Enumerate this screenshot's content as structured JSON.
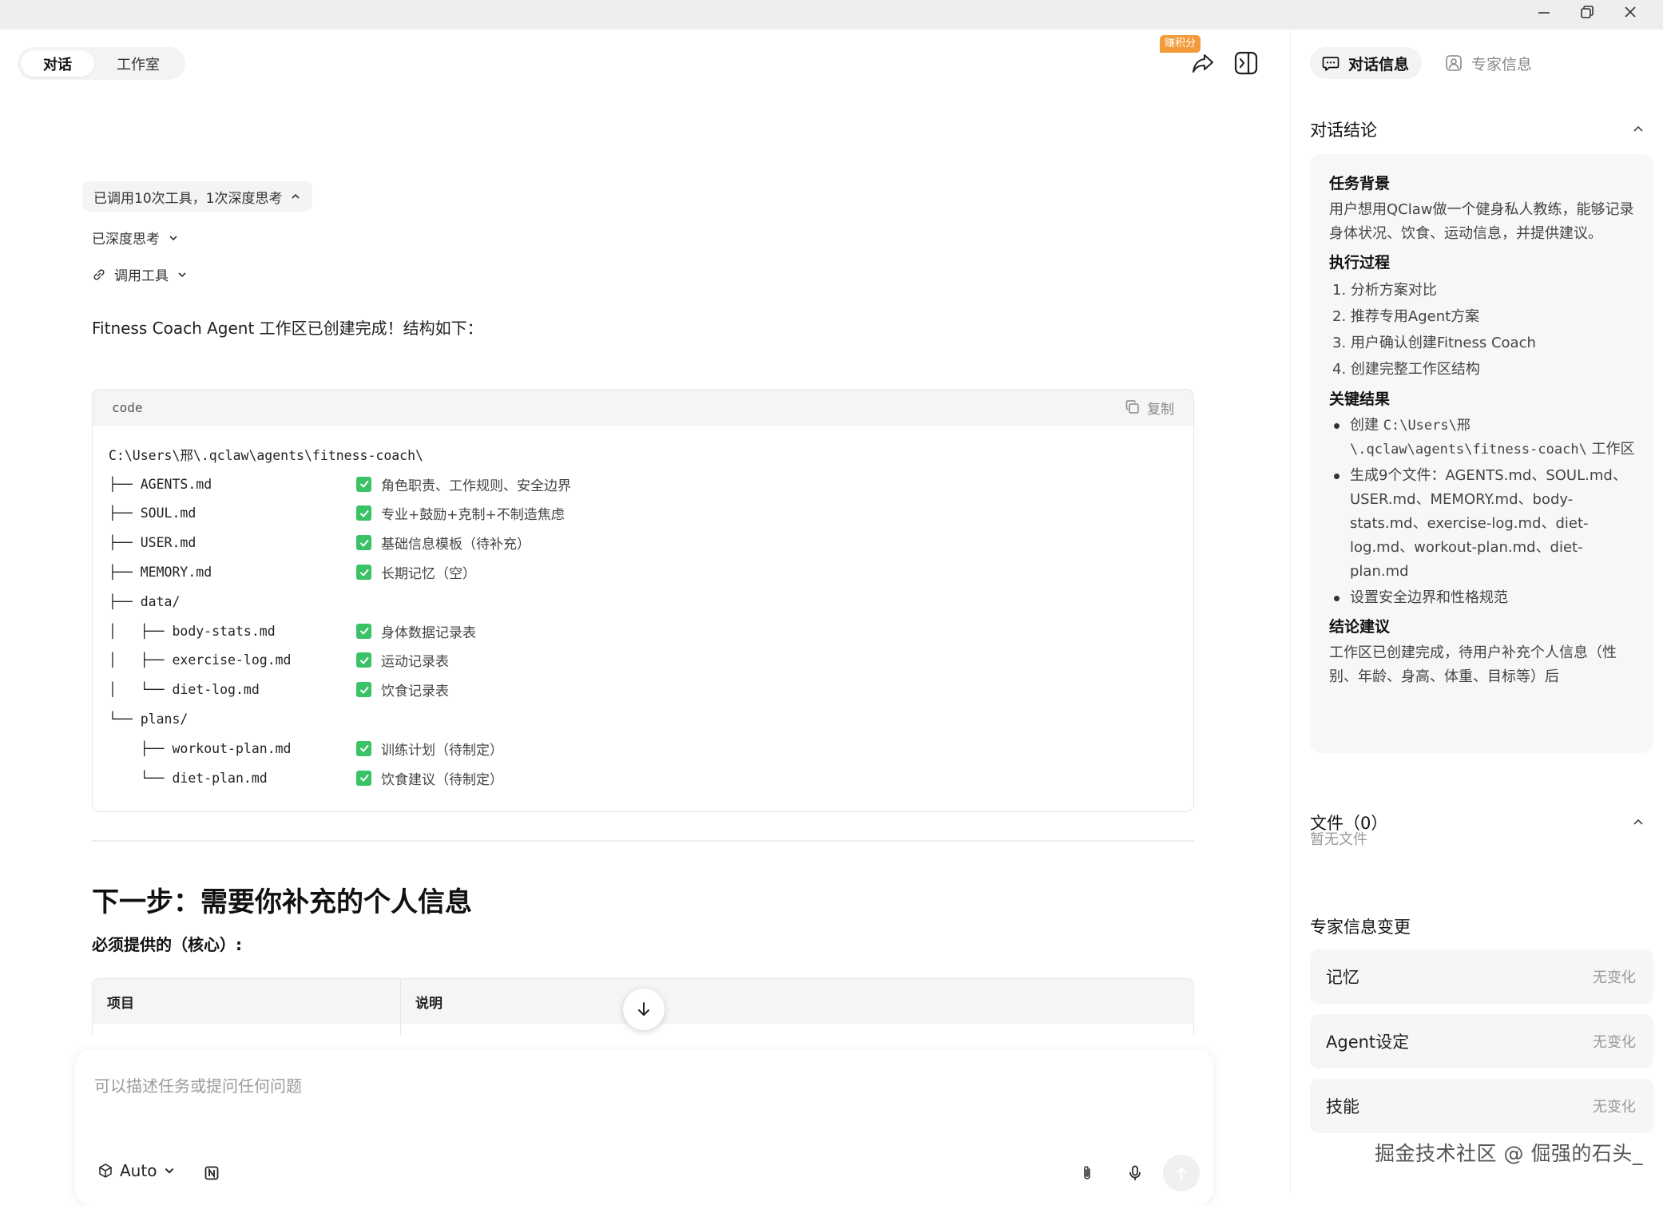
{
  "window": {
    "minimize": "minimize",
    "restore": "restore",
    "close": "close"
  },
  "mode_switch": {
    "chat": "对话",
    "studio": "工作室"
  },
  "header": {
    "badge": "赚积分"
  },
  "chat": {
    "tool_summary": "已调用10次工具，1次深度思考",
    "deep_think": "已深度思考",
    "tool_call": "调用工具",
    "intro": "Fitness Coach Agent 工作区已创建完成！结构如下：",
    "code": {
      "lang": "code",
      "copy": "复制",
      "root": "C:\\Users\\邢\\.qclaw\\agents\\fitness-coach\\",
      "rows": [
        {
          "prefix": "├── ",
          "name": "AGENTS.md",
          "note": "角色职责、工作规则、安全边界"
        },
        {
          "prefix": "├── ",
          "name": "SOUL.md",
          "note": "专业+鼓励+克制+不制造焦虑"
        },
        {
          "prefix": "├── ",
          "name": "USER.md",
          "note": "基础信息模板（待补充）"
        },
        {
          "prefix": "├── ",
          "name": "MEMORY.md",
          "note": "长期记忆（空）"
        },
        {
          "prefix": "├── ",
          "name": "data/",
          "note": ""
        },
        {
          "prefix": "│   ├── ",
          "name": "body-stats.md",
          "note": "身体数据记录表"
        },
        {
          "prefix": "│   ├── ",
          "name": "exercise-log.md",
          "note": "运动记录表"
        },
        {
          "prefix": "│   └── ",
          "name": "diet-log.md",
          "note": "饮食记录表"
        },
        {
          "prefix": "└── ",
          "name": "plans/",
          "note": ""
        },
        {
          "prefix": "    ├── ",
          "name": "workout-plan.md",
          "note": "训练计划（待制定）"
        },
        {
          "prefix": "    └── ",
          "name": "diet-plan.md",
          "note": "饮食建议（待制定）"
        }
      ]
    },
    "next_heading": "下一步：需要你补充的个人信息",
    "required_heading": "必须提供的（核心）:",
    "table": {
      "col_item": "项目",
      "col_desc": "说明"
    }
  },
  "composer": {
    "placeholder": "可以描述任务或提问任何问题",
    "model": "Auto"
  },
  "right_panel": {
    "tab_chat_info": "对话信息",
    "tab_expert_info": "专家信息",
    "conclusion_title": "对话结论",
    "summary": {
      "bg_title": "任务背景",
      "bg_text": "用户想用QClaw做一个健身私人教练，能够记录身体状况、饮食、运动信息，并提供建议。",
      "process_title": "执行过程",
      "process_items": [
        "1. 分析方案对比",
        "2. 推荐专用Agent方案",
        "3. 用户确认创建Fitness Coach",
        "4. 创建完整工作区结构"
      ],
      "result_title": "关键结果",
      "result_1_pre": "创建 ",
      "result_1_path": "C:\\Users\\邢\\.qclaw\\agents\\fitness-coach\\",
      "result_1_post": " 工作区",
      "result_2": "生成9个文件：AGENTS.md、SOUL.md、USER.md、MEMORY.md、body-stats.md、exercise-log.md、diet-log.md、workout-plan.md、diet-plan.md",
      "result_3": "设置安全边界和性格规范",
      "advice_title": "结论建议",
      "advice_text": "工作区已创建完成，待用户补充个人信息（性别、年龄、身高、体重、目标等）后"
    },
    "files_title": "文件（0）",
    "no_files": "暂无文件",
    "changes_title": "专家信息变更",
    "changes": [
      {
        "label": "记忆",
        "value": "无变化"
      },
      {
        "label": "Agent设定",
        "value": "无变化"
      },
      {
        "label": "技能",
        "value": "无变化"
      }
    ],
    "watermark": "掘金技术社区 @ 倔强的石头_"
  }
}
